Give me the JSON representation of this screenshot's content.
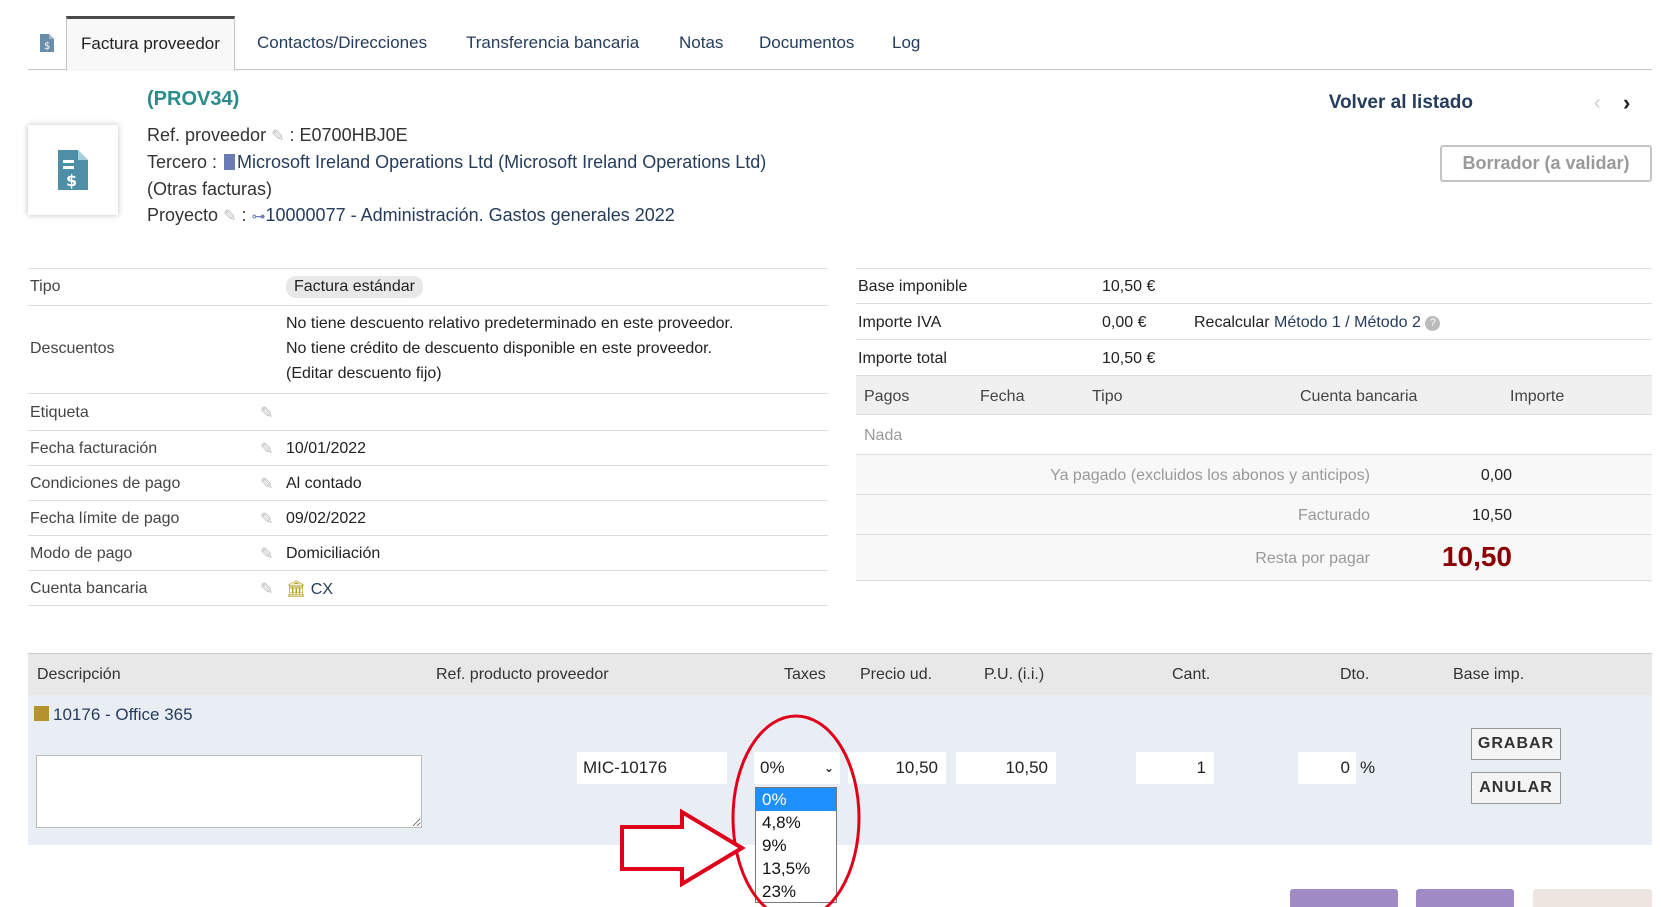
{
  "tabs": [
    {
      "label": "Factura proveedor"
    },
    {
      "label": "Contactos/Direcciones"
    },
    {
      "label": "Transferencia bancaria"
    },
    {
      "label": "Notas"
    },
    {
      "label": "Documentos"
    },
    {
      "label": "Log"
    }
  ],
  "header": {
    "ref": "(PROV34)",
    "ref_supplier_label": "Ref. proveedor",
    "ref_supplier_value": "E0700HBJ0E",
    "thirdparty_label": "Tercero :",
    "thirdparty_value": "Microsoft Ireland Operations Ltd (Microsoft Ireland Operations Ltd)",
    "other_invoices": "(Otras facturas)",
    "project_label": "Proyecto",
    "project_value": "10000077 - Administración. Gastos generales 2022",
    "back_link": "Volver al listado",
    "status": "Borrador (a validar)"
  },
  "details": {
    "tipo_label": "Tipo",
    "tipo_value": "Factura estándar",
    "descuentos_label": "Descuentos",
    "desc_line1": "No tiene descuento relativo predeterminado en este proveedor.",
    "desc_line2": "No tiene crédito de descuento disponible en este proveedor.",
    "desc_edit": "(Editar descuento fijo)",
    "etiqueta_label": "Etiqueta",
    "fecha_fact_label": "Fecha facturación",
    "fecha_fact_value": "10/01/2022",
    "cond_pago_label": "Condiciones de pago",
    "cond_pago_value": "Al contado",
    "fecha_lim_label": "Fecha límite de pago",
    "fecha_lim_value": "09/02/2022",
    "modo_pago_label": "Modo de pago",
    "modo_pago_value": "Domiciliación",
    "cuenta_label": "Cuenta bancaria",
    "cuenta_value": "CX"
  },
  "totals": {
    "base_label": "Base imponible",
    "base_value": "10,50 €",
    "iva_label": "Importe IVA",
    "iva_value": "0,00 €",
    "recalc_label": "Recalcular",
    "metodo1": "Método 1",
    "sep": "/",
    "metodo2": "Método 2",
    "total_label": "Importe total",
    "total_value": "10,50 €"
  },
  "payments": {
    "headers": [
      "Pagos",
      "Fecha",
      "Tipo",
      "Cuenta bancaria",
      "Importe"
    ],
    "empty": "Nada",
    "paid_label": "Ya pagado (excluidos los abonos y anticipos)",
    "paid_value": "0,00",
    "billed_label": "Facturado",
    "billed_value": "10,50",
    "remain_label": "Resta por pagar",
    "remain_value": "10,50"
  },
  "lines": {
    "headers": {
      "desc": "Descripción",
      "ref": "Ref. producto proveedor",
      "taxes": "Taxes",
      "price": "Precio ud.",
      "pu": "P.U. (i.i.)",
      "qty": "Cant.",
      "dto": "Dto.",
      "base": "Base imp."
    },
    "product": "10176 - Office 365",
    "ref_value": "MIC-10176",
    "tax_selected": "0%",
    "price_value": "10,50",
    "pu_value": "10,50",
    "qty_value": "1",
    "dto_value": "0",
    "dto_unit": "%",
    "save_label": "GRABAR",
    "cancel_label": "ANULAR",
    "tax_options": [
      "0%",
      "4,8%",
      "9%",
      "13,5%",
      "23%"
    ]
  },
  "colors": {
    "accent": "#263c5c",
    "ref_color": "#2a8b8b",
    "remain_color": "#8b0000",
    "annotation": "#e0001a",
    "select_highlight": "#1e90ff"
  }
}
